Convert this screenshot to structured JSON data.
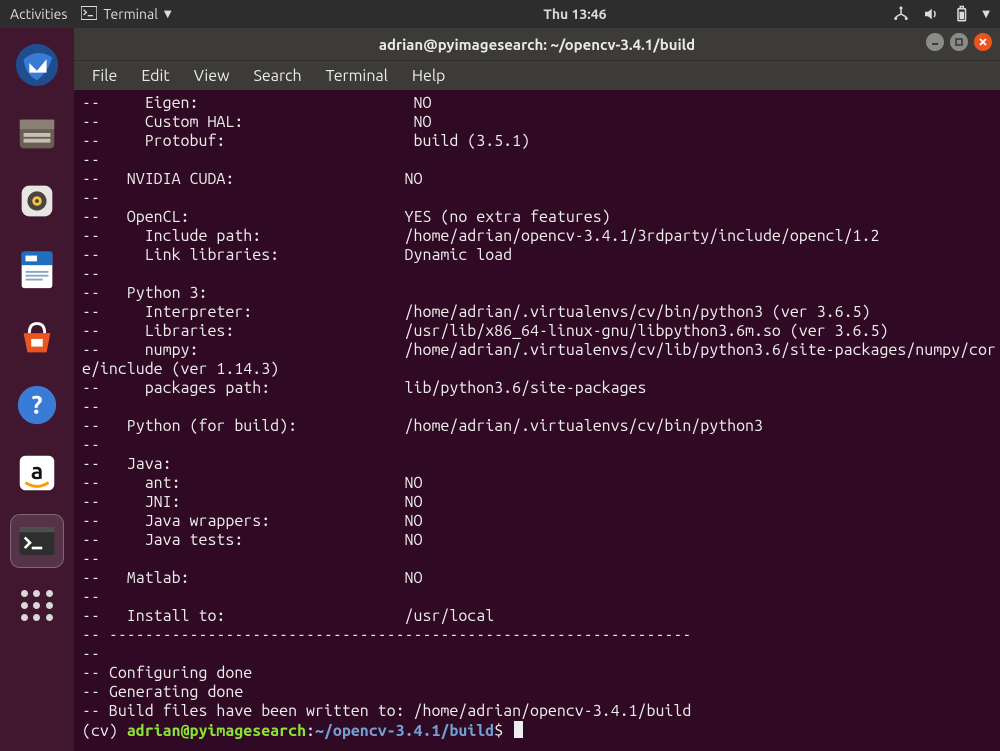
{
  "topbar": {
    "activities": "Activities",
    "app_name": "Terminal",
    "clock": "Thu 13:46"
  },
  "window": {
    "title": "adrian@pyimagesearch: ~/opencv-3.4.1/build"
  },
  "menubar": {
    "file": "File",
    "edit": "Edit",
    "view": "View",
    "search": "Search",
    "terminal": "Terminal",
    "help": "Help"
  },
  "terminal_lines": [
    "--     Eigen:                        NO",
    "--     Custom HAL:                   NO",
    "--     Protobuf:                     build (3.5.1)",
    "--",
    "--   NVIDIA CUDA:                   NO",
    "--",
    "--   OpenCL:                        YES (no extra features)",
    "--     Include path:                /home/adrian/opencv-3.4.1/3rdparty/include/opencl/1.2",
    "--     Link libraries:              Dynamic load",
    "--",
    "--   Python 3:",
    "--     Interpreter:                 /home/adrian/.virtualenvs/cv/bin/python3 (ver 3.6.5)",
    "--     Libraries:                   /usr/lib/x86_64-linux-gnu/libpython3.6m.so (ver 3.6.5)",
    "--     numpy:                       /home/adrian/.virtualenvs/cv/lib/python3.6/site-packages/numpy/cor",
    "e/include (ver 1.14.3)",
    "--     packages path:               lib/python3.6/site-packages",
    "--",
    "--   Python (for build):            /home/adrian/.virtualenvs/cv/bin/python3",
    "--",
    "--   Java:",
    "--     ant:                         NO",
    "--     JNI:                         NO",
    "--     Java wrappers:               NO",
    "--     Java tests:                  NO",
    "--",
    "--   Matlab:                        NO",
    "--",
    "--   Install to:                    /usr/local",
    "-- -----------------------------------------------------------------",
    "--",
    "-- Configuring done",
    "-- Generating done",
    "-- Build files have been written to: /home/adrian/opencv-3.4.1/build"
  ],
  "prompt": {
    "venv": "(cv) ",
    "user": "adrian",
    "at": "@",
    "host": "pyimagesearch",
    "colon": ":",
    "path": "~/opencv-3.4.1/build",
    "dollar": "$"
  }
}
